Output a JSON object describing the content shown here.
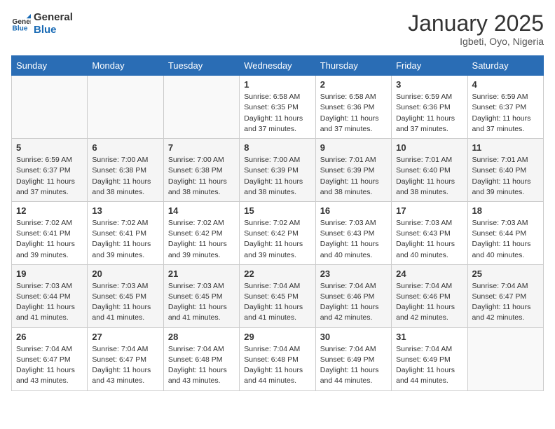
{
  "logo": {
    "line1": "General",
    "line2": "Blue"
  },
  "title": "January 2025",
  "location": "Igbeti, Oyo, Nigeria",
  "weekdays": [
    "Sunday",
    "Monday",
    "Tuesday",
    "Wednesday",
    "Thursday",
    "Friday",
    "Saturday"
  ],
  "weeks": [
    [
      {
        "day": "",
        "info": ""
      },
      {
        "day": "",
        "info": ""
      },
      {
        "day": "",
        "info": ""
      },
      {
        "day": "1",
        "info": "Sunrise: 6:58 AM\nSunset: 6:35 PM\nDaylight: 11 hours\nand 37 minutes."
      },
      {
        "day": "2",
        "info": "Sunrise: 6:58 AM\nSunset: 6:36 PM\nDaylight: 11 hours\nand 37 minutes."
      },
      {
        "day": "3",
        "info": "Sunrise: 6:59 AM\nSunset: 6:36 PM\nDaylight: 11 hours\nand 37 minutes."
      },
      {
        "day": "4",
        "info": "Sunrise: 6:59 AM\nSunset: 6:37 PM\nDaylight: 11 hours\nand 37 minutes."
      }
    ],
    [
      {
        "day": "5",
        "info": "Sunrise: 6:59 AM\nSunset: 6:37 PM\nDaylight: 11 hours\nand 37 minutes."
      },
      {
        "day": "6",
        "info": "Sunrise: 7:00 AM\nSunset: 6:38 PM\nDaylight: 11 hours\nand 38 minutes."
      },
      {
        "day": "7",
        "info": "Sunrise: 7:00 AM\nSunset: 6:38 PM\nDaylight: 11 hours\nand 38 minutes."
      },
      {
        "day": "8",
        "info": "Sunrise: 7:00 AM\nSunset: 6:39 PM\nDaylight: 11 hours\nand 38 minutes."
      },
      {
        "day": "9",
        "info": "Sunrise: 7:01 AM\nSunset: 6:39 PM\nDaylight: 11 hours\nand 38 minutes."
      },
      {
        "day": "10",
        "info": "Sunrise: 7:01 AM\nSunset: 6:40 PM\nDaylight: 11 hours\nand 38 minutes."
      },
      {
        "day": "11",
        "info": "Sunrise: 7:01 AM\nSunset: 6:40 PM\nDaylight: 11 hours\nand 39 minutes."
      }
    ],
    [
      {
        "day": "12",
        "info": "Sunrise: 7:02 AM\nSunset: 6:41 PM\nDaylight: 11 hours\nand 39 minutes."
      },
      {
        "day": "13",
        "info": "Sunrise: 7:02 AM\nSunset: 6:41 PM\nDaylight: 11 hours\nand 39 minutes."
      },
      {
        "day": "14",
        "info": "Sunrise: 7:02 AM\nSunset: 6:42 PM\nDaylight: 11 hours\nand 39 minutes."
      },
      {
        "day": "15",
        "info": "Sunrise: 7:02 AM\nSunset: 6:42 PM\nDaylight: 11 hours\nand 39 minutes."
      },
      {
        "day": "16",
        "info": "Sunrise: 7:03 AM\nSunset: 6:43 PM\nDaylight: 11 hours\nand 40 minutes."
      },
      {
        "day": "17",
        "info": "Sunrise: 7:03 AM\nSunset: 6:43 PM\nDaylight: 11 hours\nand 40 minutes."
      },
      {
        "day": "18",
        "info": "Sunrise: 7:03 AM\nSunset: 6:44 PM\nDaylight: 11 hours\nand 40 minutes."
      }
    ],
    [
      {
        "day": "19",
        "info": "Sunrise: 7:03 AM\nSunset: 6:44 PM\nDaylight: 11 hours\nand 41 minutes."
      },
      {
        "day": "20",
        "info": "Sunrise: 7:03 AM\nSunset: 6:45 PM\nDaylight: 11 hours\nand 41 minutes."
      },
      {
        "day": "21",
        "info": "Sunrise: 7:03 AM\nSunset: 6:45 PM\nDaylight: 11 hours\nand 41 minutes."
      },
      {
        "day": "22",
        "info": "Sunrise: 7:04 AM\nSunset: 6:45 PM\nDaylight: 11 hours\nand 41 minutes."
      },
      {
        "day": "23",
        "info": "Sunrise: 7:04 AM\nSunset: 6:46 PM\nDaylight: 11 hours\nand 42 minutes."
      },
      {
        "day": "24",
        "info": "Sunrise: 7:04 AM\nSunset: 6:46 PM\nDaylight: 11 hours\nand 42 minutes."
      },
      {
        "day": "25",
        "info": "Sunrise: 7:04 AM\nSunset: 6:47 PM\nDaylight: 11 hours\nand 42 minutes."
      }
    ],
    [
      {
        "day": "26",
        "info": "Sunrise: 7:04 AM\nSunset: 6:47 PM\nDaylight: 11 hours\nand 43 minutes."
      },
      {
        "day": "27",
        "info": "Sunrise: 7:04 AM\nSunset: 6:47 PM\nDaylight: 11 hours\nand 43 minutes."
      },
      {
        "day": "28",
        "info": "Sunrise: 7:04 AM\nSunset: 6:48 PM\nDaylight: 11 hours\nand 43 minutes."
      },
      {
        "day": "29",
        "info": "Sunrise: 7:04 AM\nSunset: 6:48 PM\nDaylight: 11 hours\nand 44 minutes."
      },
      {
        "day": "30",
        "info": "Sunrise: 7:04 AM\nSunset: 6:49 PM\nDaylight: 11 hours\nand 44 minutes."
      },
      {
        "day": "31",
        "info": "Sunrise: 7:04 AM\nSunset: 6:49 PM\nDaylight: 11 hours\nand 44 minutes."
      },
      {
        "day": "",
        "info": ""
      }
    ]
  ]
}
